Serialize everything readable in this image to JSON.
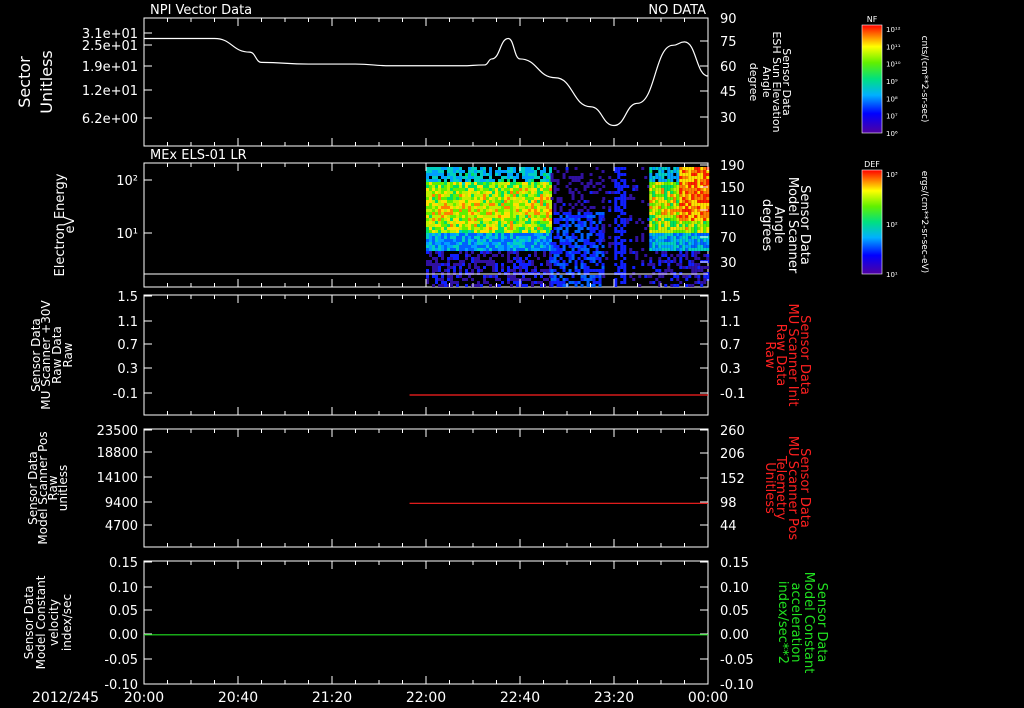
{
  "colors": {
    "background": "#000000",
    "frame": "#ffffff",
    "text": "#ffffff",
    "red_trace": "#ff2020",
    "green_trace": "#20e020"
  },
  "time_axis": {
    "date_label": "2012/245",
    "ticks": [
      "20:00",
      "20:40",
      "21:20",
      "22:00",
      "22:40",
      "23:20",
      "00:00"
    ]
  },
  "chart_data": [
    {
      "type": "line",
      "title": "NPI Vector Data",
      "status": "NO DATA",
      "left_axis": {
        "label_lines": [
          "Sector",
          "Unitless"
        ],
        "ticks": [
          "3.1e+01",
          "2.5e+01",
          "1.9e+01",
          "1.2e+01",
          "6.2e+00"
        ]
      },
      "right_axis": {
        "label_lines": [
          "Sensor Data",
          "ESH Sun Elevation",
          "Angle",
          "degree"
        ],
        "ticks": [
          "90",
          "75",
          "60",
          "45",
          "30"
        ],
        "ylim": [
          15,
          90
        ]
      },
      "series": [
        {
          "color": "#ffffff",
          "x": [
            "20:00",
            "20:30",
            "20:45",
            "20:50",
            "21:10",
            "21:30",
            "21:45",
            "22:00",
            "22:15",
            "22:25",
            "22:28",
            "22:35",
            "22:40",
            "22:55",
            "23:10",
            "23:20",
            "23:30",
            "23:45",
            "23:50",
            "24:00"
          ],
          "y": [
            78,
            78,
            70,
            64,
            63,
            63,
            62,
            62,
            62,
            62.5,
            66,
            78,
            66,
            55,
            38,
            27,
            40,
            74,
            76,
            56
          ]
        }
      ]
    },
    {
      "type": "heatmap",
      "title": "MEx ELS-01 LR",
      "left_axis": {
        "label_lines": [
          "Electron Energy",
          "eV"
        ],
        "ticks": [
          "10²",
          "10¹"
        ],
        "scale": "log"
      },
      "right_axis": {
        "label_lines": [
          "Sensor Data",
          "Model Scanner",
          "Angle",
          "degrees"
        ],
        "ticks": [
          "190",
          "150",
          "110",
          "70",
          "30"
        ]
      },
      "data_coverage": [
        {
          "start": "22:00",
          "end": "22:53",
          "level": "high",
          "note": "broad green/yellow band"
        },
        {
          "start": "22:53",
          "end": "23:15",
          "level": "low"
        },
        {
          "start": "23:15",
          "end": "23:35",
          "level": "sparse"
        },
        {
          "start": "23:35",
          "end": "24:00",
          "level": "high",
          "note": "intensity peaks at end"
        }
      ],
      "line_series": {
        "color": "#ffffff",
        "x": [
          "20:00",
          "24:00"
        ],
        "y": [
          15,
          15
        ]
      }
    },
    {
      "type": "line",
      "left_axis": {
        "label_lines": [
          "Sensor Data",
          "MU Scanner +30V",
          "Raw Data",
          "Raw"
        ],
        "ticks": [
          "1.5",
          "1.1",
          "0.7",
          "0.3",
          "-0.1"
        ],
        "ylim": [
          -0.3,
          1.5
        ]
      },
      "right_axis": {
        "label_lines": [
          "Sensor Data",
          "MU Scanner Init",
          "Raw Data",
          "Raw"
        ],
        "ticks": [
          "1.5",
          "1.1",
          "0.7",
          "0.3",
          "-0.1"
        ],
        "color": "#ff2020"
      },
      "series": [
        {
          "color": "#ff2020",
          "x": [
            "21:53",
            "24:00"
          ],
          "y": [
            0,
            0
          ]
        }
      ]
    },
    {
      "type": "line",
      "left_axis": {
        "label_lines": [
          "Sensor Data",
          "Model Scanner Pos",
          "Raw",
          "unitless"
        ],
        "ticks": [
          "23500",
          "18800",
          "14100",
          "9400",
          "4700"
        ]
      },
      "right_axis": {
        "label_lines": [
          "Sensor Data",
          "MU Scanner Pos",
          "Telemetry",
          "Unitless"
        ],
        "ticks": [
          "260",
          "206",
          "152",
          "98",
          "44"
        ],
        "ylim": [
          -10,
          260
        ],
        "color": "#ff2020"
      },
      "series": [
        {
          "color": "#ff2020",
          "x": [
            "21:53",
            "24:00"
          ],
          "y": [
            90,
            90
          ]
        }
      ]
    },
    {
      "type": "line",
      "left_axis": {
        "label_lines": [
          "Sensor Data",
          "Model Constant",
          "velocity",
          "index/sec"
        ],
        "ticks": [
          "0.15",
          "0.10",
          "0.05",
          "0.00",
          "-0.05",
          "-0.10"
        ],
        "ylim": [
          -0.1,
          0.15
        ]
      },
      "right_axis": {
        "label_lines": [
          "Sensor Data",
          "Model Constant",
          "acceleration",
          "index/sec**2"
        ],
        "ticks": [
          "0.15",
          "0.10",
          "0.05",
          "0.00",
          "-0.05",
          "-0.10"
        ],
        "color": "#20e020"
      },
      "series": [
        {
          "color": "#20e020",
          "x": [
            "20:00",
            "24:00"
          ],
          "y": [
            0,
            0
          ]
        }
      ]
    }
  ],
  "colorbars": [
    {
      "name": "NF",
      "unit": "cnts/(cm**2-sr-sec)",
      "ticks": [
        "10¹²",
        "10¹¹",
        "10¹⁰",
        "10⁹",
        "10⁸",
        "10⁷",
        "10⁶"
      ]
    },
    {
      "name": "DEF",
      "unit": "ergs/(cm**2-sr-sec-eV)",
      "ticks": [
        "10³",
        "10²",
        "10¹"
      ]
    }
  ]
}
